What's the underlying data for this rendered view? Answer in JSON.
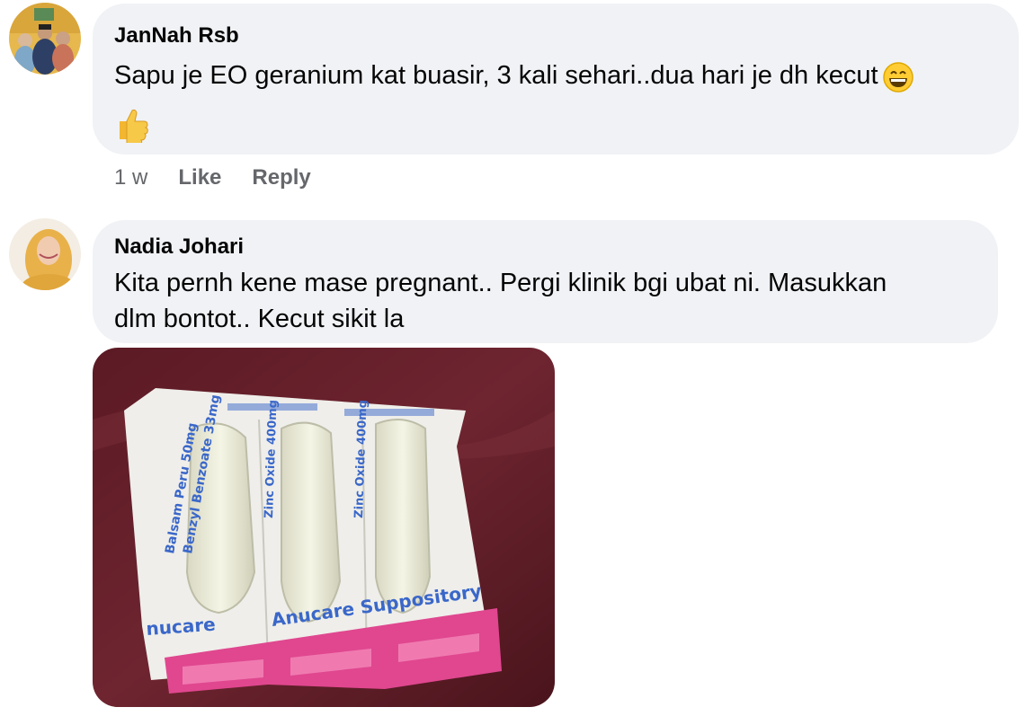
{
  "comments": [
    {
      "author": "JanNah Rsb",
      "text": "Sapu je EO geranium kat buasir, 3 kali sehari..dua hari je dh kecut",
      "emoji_inline": "grinning-face-with-smiling-eyes",
      "emoji_line": "thumbs-up",
      "time": "1 w",
      "like_label": "Like",
      "reply_label": "Reply"
    },
    {
      "author": "Nadia Johari",
      "text_line1": "Kita pernh kene mase pregnant.. Pergi klinik bgi ubat ni. Masukkan",
      "text_line2": "dlm bontot.. Kecut sikit la",
      "photo": {
        "description_labels": [
          "Anucare Suppository"
        ],
        "package_text": [
          "Balsam Peru 50mg",
          "Benzyl Benzoate 33mg",
          "Anucare Suppository",
          "nucare"
        ]
      }
    }
  ],
  "colors": {
    "bubble": "#f0f2f5",
    "meta": "#65676b",
    "text": "#050505"
  }
}
